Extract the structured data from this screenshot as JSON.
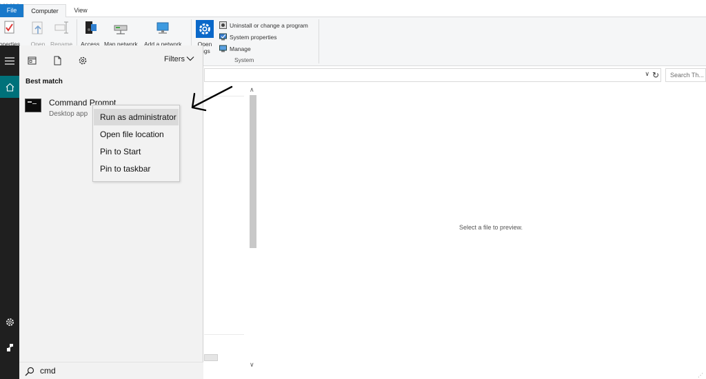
{
  "explorer": {
    "tabs": [
      {
        "label": "File"
      },
      {
        "label": "Computer"
      },
      {
        "label": "View"
      }
    ],
    "ribbon": {
      "buttons": [
        {
          "label": "roperties"
        },
        {
          "label": "Open"
        },
        {
          "label": "Rename"
        },
        {
          "label": "Access"
        },
        {
          "label": "Map network"
        },
        {
          "label": "Add a network"
        },
        {
          "label": "Open"
        },
        {
          "label": "ings"
        }
      ],
      "system_items": [
        {
          "label": "Uninstall or change a program"
        },
        {
          "label": "System properties"
        },
        {
          "label": "Manage"
        }
      ],
      "system_group_label": "System"
    },
    "search_placeholder": "Search Th...",
    "preview_text": "Select a file to preview."
  },
  "start_menu": {
    "filters_label": "Filters",
    "best_match_label": "Best match",
    "result": {
      "title": "Command Prompt",
      "subtitle": "Desktop app"
    },
    "context_menu": [
      {
        "label": "Run as administrator",
        "highlighted": true
      },
      {
        "label": "Open file location"
      },
      {
        "label": "Pin to Start"
      },
      {
        "label": "Pin to taskbar"
      }
    ],
    "search_query": "cmd"
  },
  "colors": {
    "accent_blue": "#1979ca",
    "start_rail": "#1f1f1f",
    "home_teal": "#00717a"
  }
}
